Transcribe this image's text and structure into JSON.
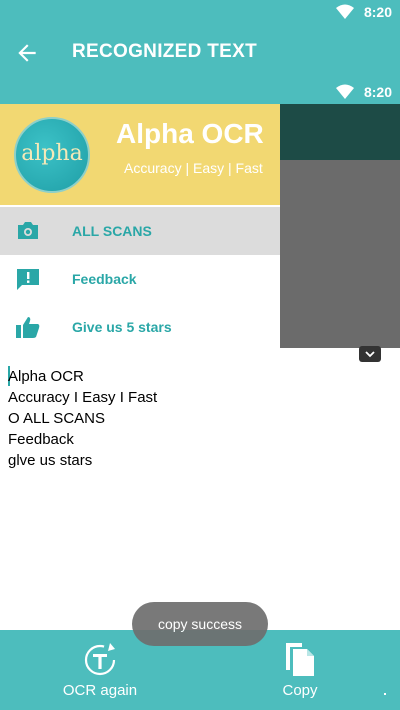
{
  "status": {
    "time": "8:20"
  },
  "appbar": {
    "title": "RECOGNIZED TEXT",
    "back_icon": "arrow-back-icon"
  },
  "screenshot": {
    "status_time": "8:20",
    "brand": "Alpha OCR",
    "tagline": "Accuracy | Easy | Fast",
    "logo_text": "alpha",
    "menu": [
      {
        "label": "ALL SCANS",
        "icon": "camera-icon"
      },
      {
        "label": "Feedback",
        "icon": "feedback-icon"
      },
      {
        "label": "Give us 5 stars",
        "icon": "thumbs-up-icon"
      }
    ]
  },
  "ocr_lines": [
    "Alpha OCR",
    "Accuracy I Easy I Fast",
    "O ALL SCANS",
    "Feedback",
    "glve us stars"
  ],
  "toast": "copy success",
  "bottom": {
    "ocr_again": "OCR again",
    "copy": "Copy"
  },
  "colors": {
    "teal": "#4dbdbd",
    "yellow": "#f2d872",
    "label_teal": "#2aa7a7"
  }
}
